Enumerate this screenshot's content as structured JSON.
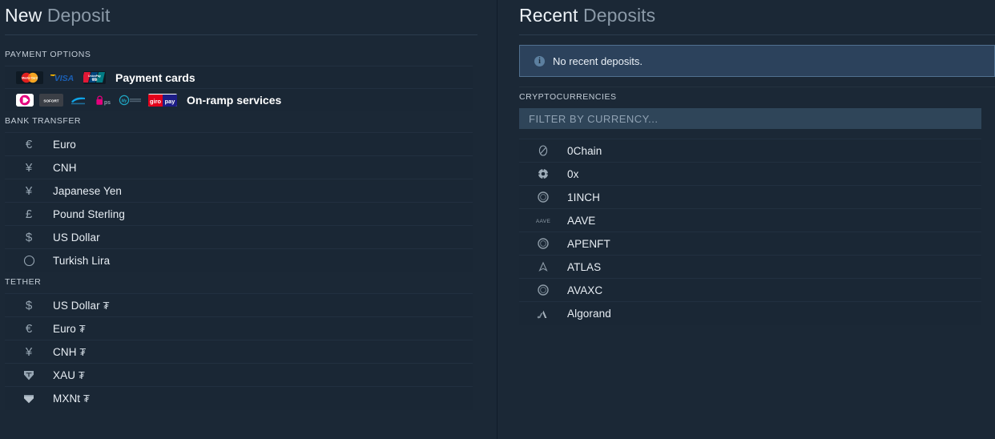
{
  "colors": {
    "page_background": "#1b2836",
    "list_background": "#1a2735",
    "divider": "#223040",
    "alert_background": "#2c425c",
    "alert_border": "#51708f",
    "input_background": "#2f4559",
    "text_primary": "#e8eef4",
    "text_muted": "#8b9aa8"
  },
  "left_panel": {
    "title_strong": "New",
    "title_weak": "Deposit",
    "payment_options": {
      "label": "PAYMENT OPTIONS",
      "rows": [
        {
          "name": "Payment cards",
          "logos": [
            "mastercard-logo",
            "visa-logo",
            "unionpay-logo"
          ]
        },
        {
          "name": "On-ramp services",
          "logos": [
            "dotpay-logo",
            "sofort-logo",
            "trustly-logo",
            "eps-logo",
            "mybank-logo",
            "giropay-logo"
          ]
        }
      ]
    },
    "bank_transfer": {
      "label": "BANK TRANSFER",
      "rows": [
        {
          "symbol": "€",
          "name": "Euro"
        },
        {
          "symbol": "¥",
          "name": "CNH"
        },
        {
          "symbol": "¥",
          "name": "Japanese Yen"
        },
        {
          "symbol": "£",
          "name": "Pound Sterling"
        },
        {
          "symbol": "$",
          "name": "US Dollar"
        },
        {
          "symbol": "◯",
          "name": "Turkish Lira"
        }
      ]
    },
    "tether": {
      "label": "TETHER",
      "mark": "₮",
      "rows": [
        {
          "symbol": "$",
          "name": "US Dollar",
          "icon": "dollar-icon"
        },
        {
          "symbol": "€",
          "name": "Euro",
          "icon": "euro-icon"
        },
        {
          "symbol": "¥",
          "name": "CNH",
          "icon": "yen-icon"
        },
        {
          "symbol": "",
          "name": "XAU",
          "icon": "tether-gold-icon"
        },
        {
          "symbol": "",
          "name": "MXNt",
          "icon": "tether-peso-icon"
        }
      ]
    }
  },
  "right_panel": {
    "title_strong": "Recent",
    "title_weak": "Deposits",
    "alert": {
      "icon": "info-icon",
      "text": "No recent deposits."
    },
    "cryptocurrencies": {
      "label": "CRYPTOCURRENCIES",
      "filter_placeholder": "Filter by currency...",
      "filter_value": "",
      "rows": [
        {
          "name": "0Chain",
          "icon": "zerochain-icon"
        },
        {
          "name": "0x",
          "icon": "zerox-icon"
        },
        {
          "name": "1INCH",
          "icon": "oneinch-icon"
        },
        {
          "name": "AAVE",
          "icon": "aave-icon"
        },
        {
          "name": "APENFT",
          "icon": "apenft-icon"
        },
        {
          "name": "ATLAS",
          "icon": "atlas-icon"
        },
        {
          "name": "AVAXC",
          "icon": "avaxc-icon"
        },
        {
          "name": "Algorand",
          "icon": "algorand-icon"
        }
      ]
    }
  }
}
